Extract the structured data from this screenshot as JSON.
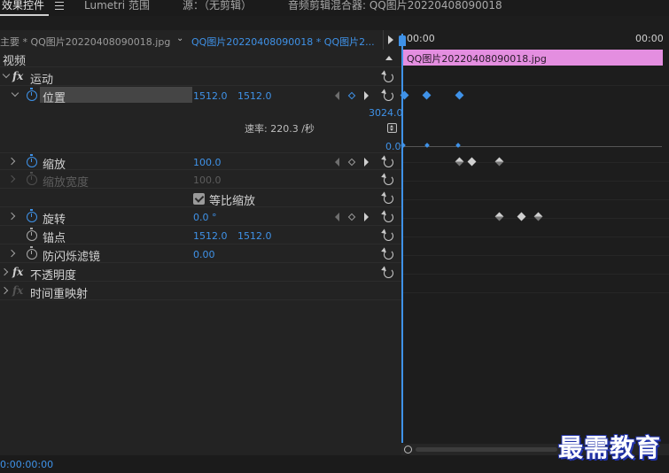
{
  "tabs": [
    {
      "label": "效果控件",
      "active": true
    },
    {
      "label": "Lumetri 范围",
      "active": false
    },
    {
      "label": "源：（无剪辑）",
      "active": false
    },
    {
      "label": "音频剪辑混合器: QQ图片20220408090018",
      "active": false
    }
  ],
  "source": {
    "master": "主要 * QQ图片20220408090018.jpg",
    "clip": "QQ图片20220408090018 * QQ图片2..."
  },
  "section": {
    "video_label": "视频"
  },
  "effects": {
    "motion": {
      "label": "运动"
    },
    "position": {
      "label": "位置",
      "x": "1512.0",
      "y": "1512.0"
    },
    "graph": {
      "max": "3024.0",
      "min": "0.0",
      "speed": "速率: 220.3 /秒"
    },
    "scale": {
      "label": "缩放",
      "value": "100.0"
    },
    "scale_width": {
      "label": "缩放宽度",
      "value": "100.0"
    },
    "uniform_scale": {
      "label": "等比缩放",
      "checked": true
    },
    "rotation": {
      "label": "旋转",
      "value": "0.0 °"
    },
    "anchor": {
      "label": "锚点",
      "x": "1512.0",
      "y": "1512.0"
    },
    "flicker": {
      "label": "防闪烁滤镜",
      "value": "0.00"
    },
    "opacity": {
      "label": "不透明度"
    },
    "time_remap": {
      "label": "时间重映射"
    },
    "fx_symbol": "fx"
  },
  "timeline": {
    "start": "00:00",
    "end": "00:00",
    "clip_name": "QQ图片20220408090018.jpg"
  },
  "footer": {
    "timecode": "0:00:00:00"
  },
  "watermark": "最需教育",
  "colors": {
    "accent": "#3f92e8",
    "clip": "#e48ee0",
    "panel": "#232323"
  }
}
